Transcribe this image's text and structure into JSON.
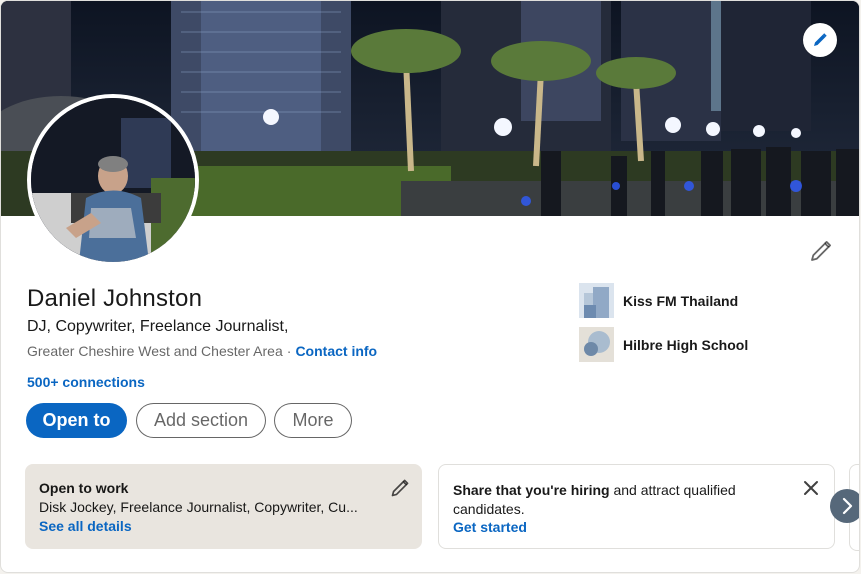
{
  "profile": {
    "name": "Daniel Johnston",
    "headline": "DJ, Copywriter, Freelance Journalist,",
    "location": "Greater Cheshire West and Chester Area",
    "separator": "·",
    "contact_info": "Contact info",
    "connections": "500+ connections"
  },
  "actions": {
    "open_to": "Open to",
    "add_section": "Add section",
    "more": "More"
  },
  "organizations": [
    {
      "name": "Kiss FM Thailand",
      "icon": "company-logo"
    },
    {
      "name": "Hilbre High School",
      "icon": "school-logo"
    }
  ],
  "open_to_work": {
    "title": "Open to work",
    "description": "Disk Jockey, Freelance Journalist, Copywriter, Cu...",
    "link": "See all details"
  },
  "hiring": {
    "bold": "Share that you're hiring",
    "rest": " and attract qualified candidates.",
    "link": "Get started"
  },
  "icons": {
    "cover_edit": "pencil-icon",
    "intro_edit": "pencil-icon",
    "close": "close-icon",
    "next": "chevron-right-icon"
  },
  "colors": {
    "accent": "#0a66c2",
    "open_to_work_bg": "#e9e5df"
  }
}
